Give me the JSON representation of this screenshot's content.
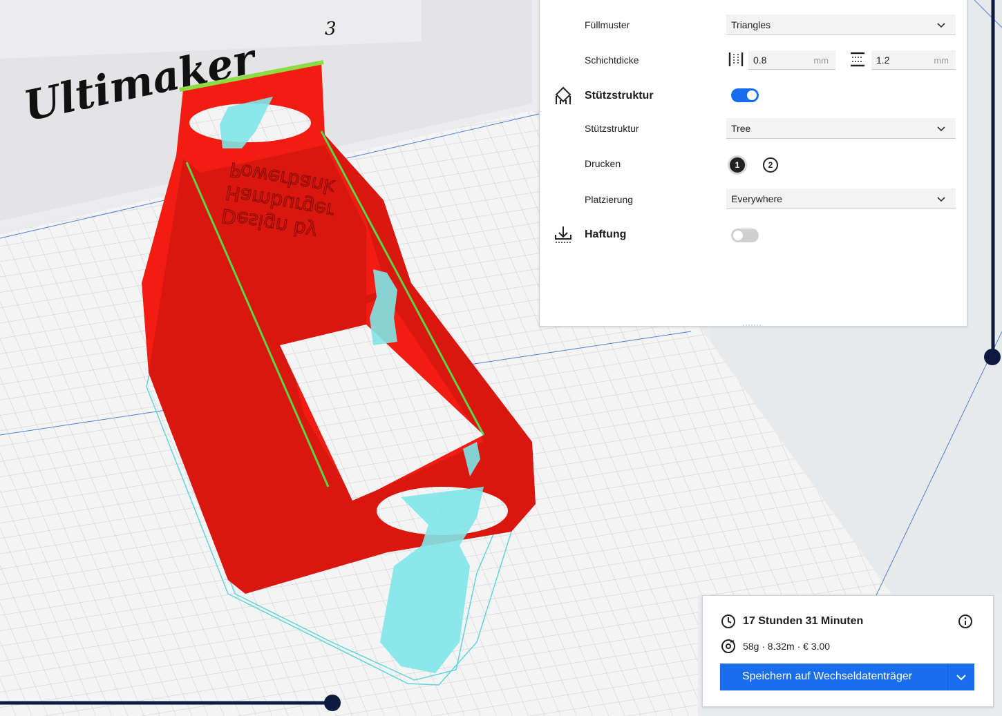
{
  "scene": {
    "printer_logo_text": "Ultimaker",
    "printer_logo_superscript": "3",
    "model_text_lines": [
      "Design by",
      "Hamburger",
      "Powerbank"
    ]
  },
  "settings": {
    "infill_pattern": {
      "label": "Füllmuster",
      "value": "Triangles"
    },
    "layer_thickness": {
      "label": "Schichtdicke",
      "wall_value": "0.8",
      "wall_unit": "mm",
      "topbottom_value": "1.2",
      "topbottom_unit": "mm"
    },
    "support": {
      "section_label": "Stützstruktur",
      "enabled": true,
      "structure_label": "Stützstruktur",
      "structure_value": "Tree",
      "print_label": "Drucken",
      "extruders": [
        "1",
        "2"
      ],
      "placement_label": "Platzierung",
      "placement_value": "Everywhere"
    },
    "adhesion": {
      "section_label": "Haftung",
      "enabled": false
    }
  },
  "print_summary": {
    "time": "17 Stunden 31 Minuten",
    "material": "58g · 8.32m · € 3.00",
    "save_button": "Speichern auf Wechseldatenträger"
  },
  "colors": {
    "accent": "#196ef0",
    "model": "#f21c13",
    "support": "#7fe5e8",
    "toggle_off": "#cfcfcf",
    "slider": "#0d1a3f"
  }
}
